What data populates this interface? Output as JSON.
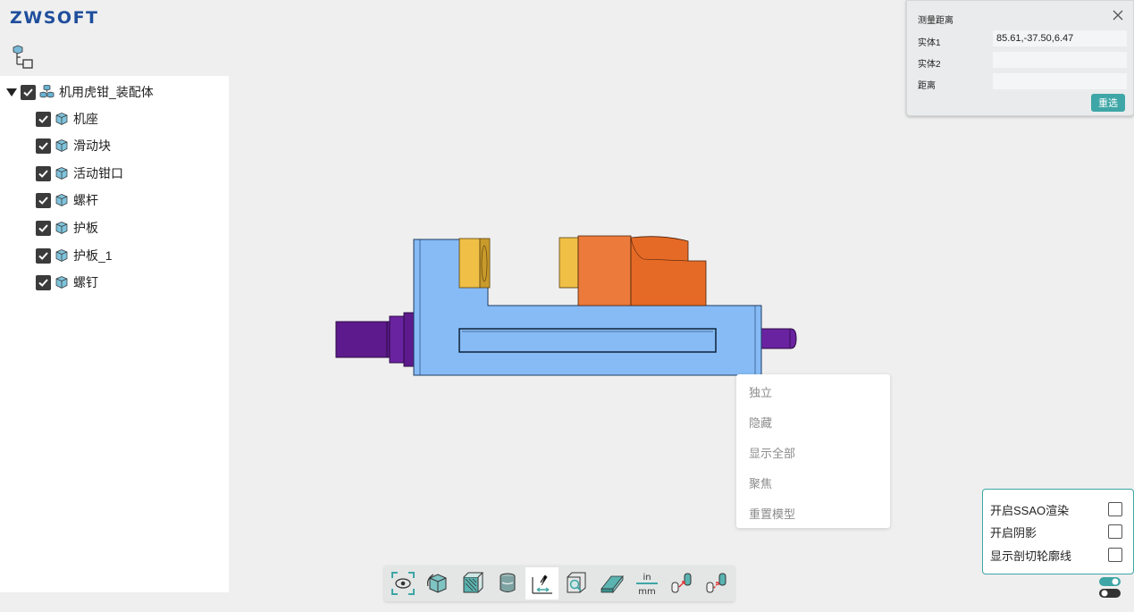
{
  "brand": {
    "logo_text": "ZWSOFT"
  },
  "tree": {
    "root": {
      "label": "机用虎钳_装配体",
      "checked": true,
      "expanded": true
    },
    "children": [
      {
        "label": "机座",
        "checked": true
      },
      {
        "label": "滑动块",
        "checked": true
      },
      {
        "label": "活动钳口",
        "checked": true
      },
      {
        "label": "螺杆",
        "checked": true
      },
      {
        "label": "护板",
        "checked": true
      },
      {
        "label": "护板_1",
        "checked": true
      },
      {
        "label": "螺钉",
        "checked": true
      }
    ]
  },
  "measure": {
    "title": "测量距离",
    "entity1_label": "实体1",
    "entity1_value": "85.61,-37.50,6.47",
    "entity2_label": "实体2",
    "entity2_value": "",
    "distance_label": "距离",
    "distance_value": "",
    "reselect_label": "重选"
  },
  "context_menu": {
    "items": [
      "独立",
      "隐藏",
      "显示全部",
      "聚焦",
      "重置模型"
    ]
  },
  "render_settings": {
    "ssao_label": "开启SSAO渲染",
    "ssao_checked": false,
    "shadow_label": "开启阴影",
    "shadow_checked": false,
    "section_outline_label": "显示剖切轮廓线",
    "section_outline_checked": false
  },
  "toolbar": {
    "tools": [
      "view-fit",
      "view-orientation",
      "section",
      "material",
      "measure",
      "zoom-window",
      "explode",
      "units",
      "transform-a",
      "transform-b"
    ],
    "active_tool": "measure",
    "units_top": "in",
    "units_bottom": "mm"
  },
  "colors": {
    "accent": "#3ea6a6",
    "base_blue": "#86bbf5",
    "jaw_orange": "#ec7a3a",
    "plate_yellow": "#efbf46",
    "screw_purple": "#5d1a8c"
  }
}
